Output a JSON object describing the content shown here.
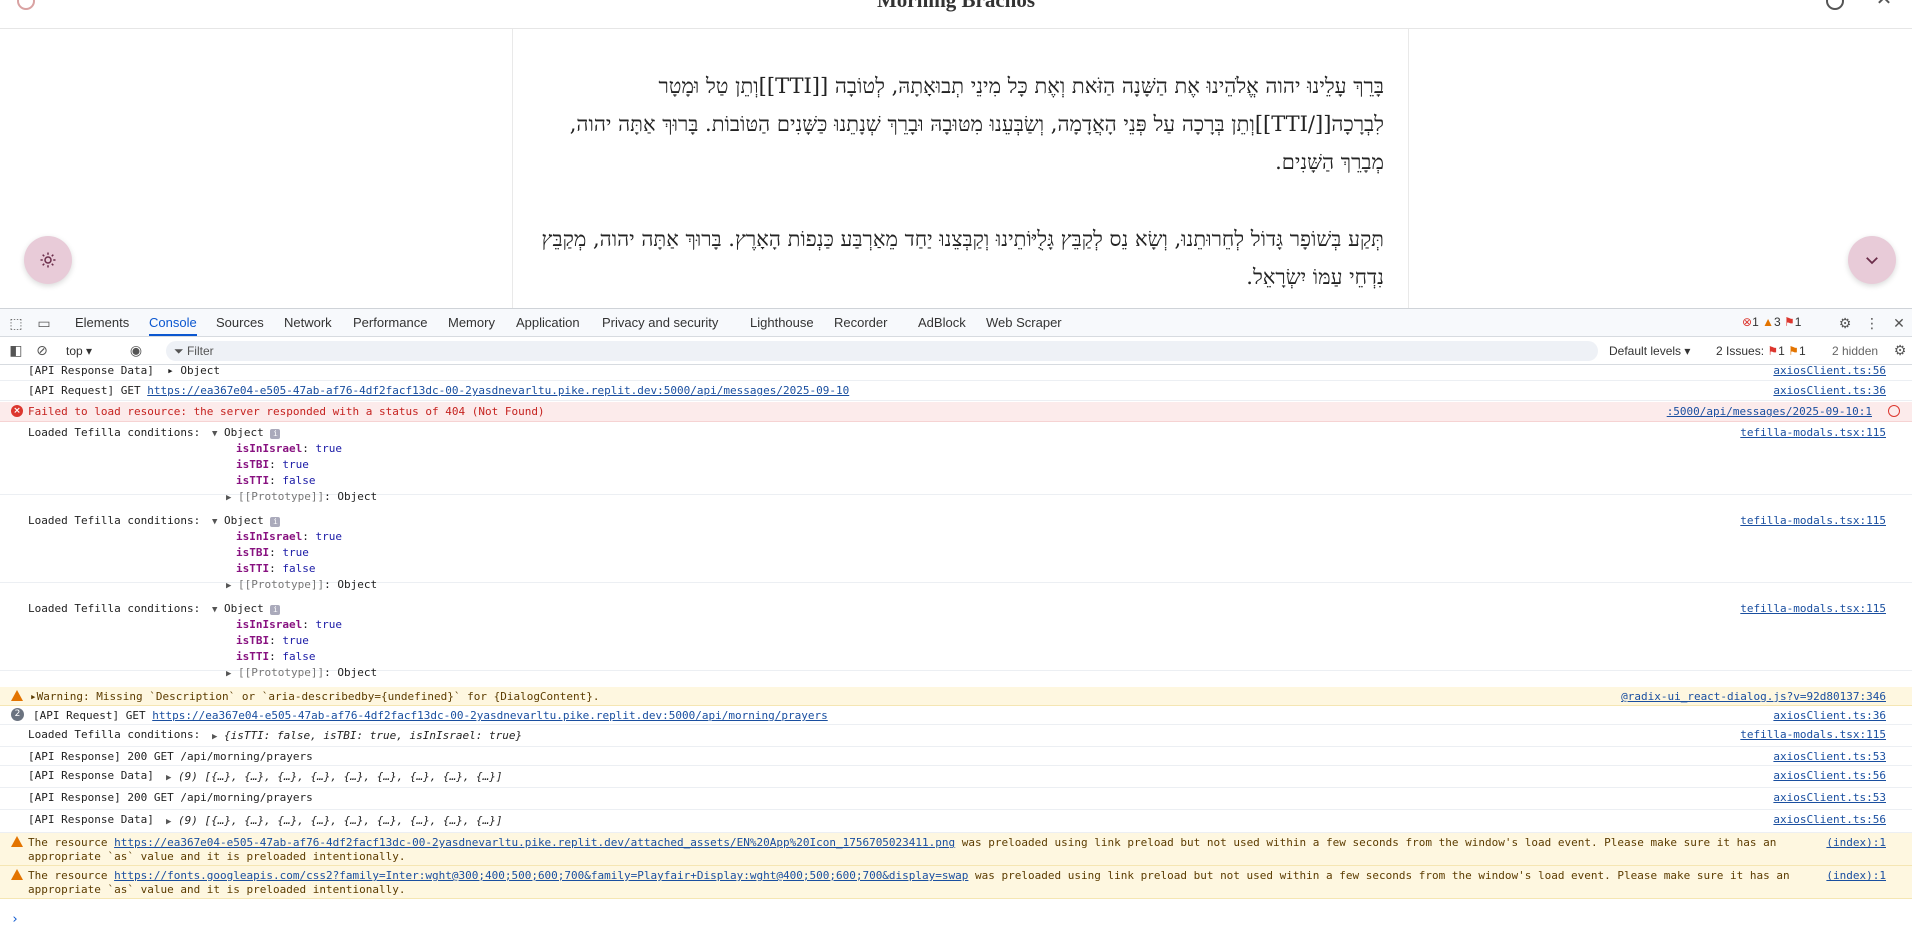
{
  "app": {
    "title": "Morning Brachos",
    "prayer_1": "בָּרֵךְ עָלֵינוּ יהוה אֱלֹהֵינוּ אֶת הַשָּׁנָה הַזֹּאת וְאֶת כָּל מִינֵי תְבוּאָתָהּ, לְטוֹבָה [[TTI]]וְתֵן טַל וּמָטָר לִבְרָכָה[[/TTI]]וְתֵן בְּרָכָה עַל פְּנֵי הָאֲדָמָה, וְשַׂבְּעֵנוּ מִטּוּבָהּ וּבָרֵךְ שְׁנָתֵנוּ כַּשָּׁנִים הַטּוֹבוֹת. בָּרוּךְ אַתָּה יהוה, מְבָרֵךְ הַשָּׁנִים.",
    "prayer_2": "תְּקַע בְּשׁוֹפָר גָּדוֹל לְחֵרוּתֵנוּ, וְשָׂא נֵס לְקַבֵּץ גָּלֻיּוֹתֵינוּ וְקַבְּצֵנוּ יַחַד מֵאַרְבַּע כַּנְפוֹת הָאָרֶץ. בָּרוּךְ אַתָּה יהוה, מְקַבֵּץ נִדְחֵי עַמּוֹ יִשְׂרָאֵל."
  },
  "devtools": {
    "tabs": [
      "Elements",
      "Console",
      "Sources",
      "Network",
      "Performance",
      "Memory",
      "Application",
      "Privacy and security",
      "Lighthouse",
      "Recorder",
      "AdBlock",
      "Web Scraper"
    ],
    "active_tab": "Console",
    "counts": {
      "errors": "1",
      "warnings": "3",
      "issues": "1"
    },
    "toolbar": {
      "context": "top",
      "filter_placeholder": "Filter",
      "levels": "Default levels",
      "issues_label": "2 Issues:",
      "issues_err": "1",
      "issues_info": "1",
      "hidden": "2 hidden"
    },
    "console": {
      "m0_text": "[API Response Data]  ▸ Object",
      "m0_src": "axiosClient.ts:56",
      "m1_prefix": "[API Request] GET ",
      "m1_link": "https://ea367e04-e505-47ab-af76-4df2facf13dc-00-2yasdnevarltu.pike.replit.dev:5000/api/messages/2025-09-10",
      "m1_src": "axiosClient.ts:36",
      "m2_text": "Failed to load resource: the server responded with a status of 404 (Not Found)",
      "m2_src": ":5000/api/messages/2025-09-10:1",
      "cond_label": "Loaded Tefilla conditions:",
      "cond_src": "tefilla-modals.tsx:115",
      "obj_head": "Object",
      "k_israel": "isInIsrael",
      "k_tbi": "isTBI",
      "k_tti": "isTTI",
      "v_true": "true",
      "v_false": "false",
      "proto": "[[Prototype]]",
      "proto_val": ": Object",
      "m6_text": "▸Warning: Missing `Description` or `aria-describedby={undefined}` for {DialogContent}.",
      "m6_src": "@radix-ui_react-dialog.js?v=92d80137:346",
      "m7_badge": "2",
      "m7_prefix": "[API Request] GET ",
      "m7_link": "https://ea367e04-e505-47ab-af76-4df2facf13dc-00-2yasdnevarltu.pike.replit.dev:5000/api/morning/prayers",
      "m7_src": "axiosClient.ts:36",
      "m8_obj": "{isTTI: false, isTBI: true, isInIsrael: true}",
      "m9_text": "[API Response] 200 GET /api/morning/prayers",
      "m9_src": "axiosClient.ts:53",
      "m10_text": "[API Response Data]",
      "m10_obj": "(9) [{…}, {…}, {…}, {…}, {…}, {…}, {…}, {…}, {…}]",
      "m10_src": "axiosClient.ts:56",
      "w1_prefix": "The resource ",
      "w1_link": "https://ea367e04-e505-47ab-af76-4df2facf13dc-00-2yasdnevarltu.pike.replit.dev/attached_assets/EN%20App%20Icon_1756705023411.png",
      "w1_suffix": " was preloaded using link preload but not used within a few seconds from the window's load event. Please make sure it has an",
      "w_line2": "appropriate `as` value and it is preloaded intentionally.",
      "w_src": "(index):1",
      "w2_link": "https://fonts.googleapis.com/css2?family=Inter:wght@300;400;500;600;700&family=Playfair+Display:wght@400;500;600;700&display=swap",
      "w2_suffix": " was preloaded using link preload but not used within a few seconds from the window's load event. Please make sure it has an",
      "prompt": "›"
    }
  }
}
